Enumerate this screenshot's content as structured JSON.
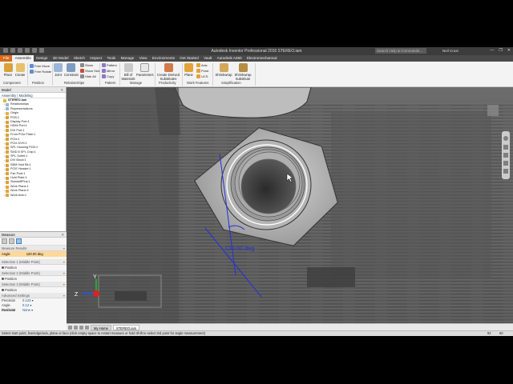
{
  "app": {
    "title": "Autodesk Inventor Professional 2016   STEREO.iam",
    "search_placeholder": "Search Help & Commands...",
    "user": "Neil Crust",
    "window_buttons": [
      "—",
      "❐",
      "✕"
    ]
  },
  "ribbon_tabs": [
    "File",
    "Assemble",
    "Design",
    "3D Model",
    "Sketch",
    "Inspect",
    "Tools",
    "Manage",
    "View",
    "Environments",
    "Get Started",
    "Vault",
    "Autodesk A360",
    "Electromechanical"
  ],
  "active_tab": "Assemble",
  "ribbon": {
    "component": {
      "label": "Component",
      "buttons": [
        "Place",
        "Create"
      ]
    },
    "position": {
      "label": "Position",
      "buttons": [
        "Free Move",
        "Free Rotate"
      ]
    },
    "relationships": {
      "label": "Relationships",
      "buttons": [
        "Joint",
        "Constrain"
      ],
      "small": [
        "Show",
        "Show Sick",
        "Hide All"
      ]
    },
    "pattern": {
      "label": "Pattern",
      "small": [
        "Pattern",
        "Mirror",
        "Copy"
      ]
    },
    "manage": {
      "label": "Manage",
      "buttons": [
        "Bill of Materials",
        "Parameters"
      ]
    },
    "productivity": {
      "label": "Productivity",
      "buttons": [
        "Create Derived Substitutes"
      ]
    },
    "work_features": {
      "label": "Work Features",
      "buttons": [
        "Plane"
      ],
      "small": [
        "Axis",
        "Point",
        "UCS"
      ]
    },
    "simplification": {
      "label": "Simplification",
      "buttons": [
        "Shrinkwrap",
        "Shrinkwrap Substitute"
      ]
    }
  },
  "model_panel": {
    "title": "Model",
    "subtabs": "Assembly | Modeling",
    "tree": [
      "STEREO.iam",
      "Relationships",
      "Representations",
      "Origin",
      "PCB:1",
      "Display Port:1",
      "HDMI Port:1",
      "DVI Port:1",
      "Front PCIe Plate:1",
      "PCIe:1",
      "PCIe DVH:1",
      "SPL Housing PCB:1",
      "SMD 8 SPL Chip:1",
      "SPL Outlet:1",
      "DVI Block:1",
      "SBM Hold Bk:1",
      "PCIE Header:1",
      "Fan Post:1",
      "Hold Plate:1",
      "StandoffPlus:1",
      "Work Plane:1",
      "Work Plane:2",
      "Work Axis:1"
    ]
  },
  "measure_panel": {
    "title": "Measure",
    "results_label": "Measure Results",
    "angle_key": "Angle",
    "angle_value": "120.00 deg",
    "selection1": "Selection 1 (Middle Point)",
    "selection1_pos": "Position",
    "selection2": "Selection 2 (Middle Point)",
    "selection2_pos": "Position",
    "selection3": "Selection 3 (Middle Point)",
    "selection3_pos": "Position",
    "advanced": "Advanced Settings",
    "settings": [
      {
        "k": "Precision",
        "v": "0.123 ▾"
      },
      {
        "k": "Angle Precision",
        "v": "0.12 ▾"
      },
      {
        "k": "Dual Unit",
        "v": "None ▾"
      }
    ]
  },
  "viewport": {
    "angle_annotation": "120.00 deg",
    "triad_y": "Y",
    "triad_z": "Z"
  },
  "doc_tabs": [
    "My Home",
    "STEREO.iam"
  ],
  "active_doc": "STEREO.iam",
  "status": {
    "prompt": "Select start point, line/edge/axis, plane or face (click empty space to restart measure or hold Shift to select 3rd point for angle measurement)",
    "count1": "92",
    "count2": "60"
  },
  "colors": {
    "file_tab": "#d86d1c",
    "measure_highlight": "#ffd89a",
    "annotation": "#2430d8"
  }
}
